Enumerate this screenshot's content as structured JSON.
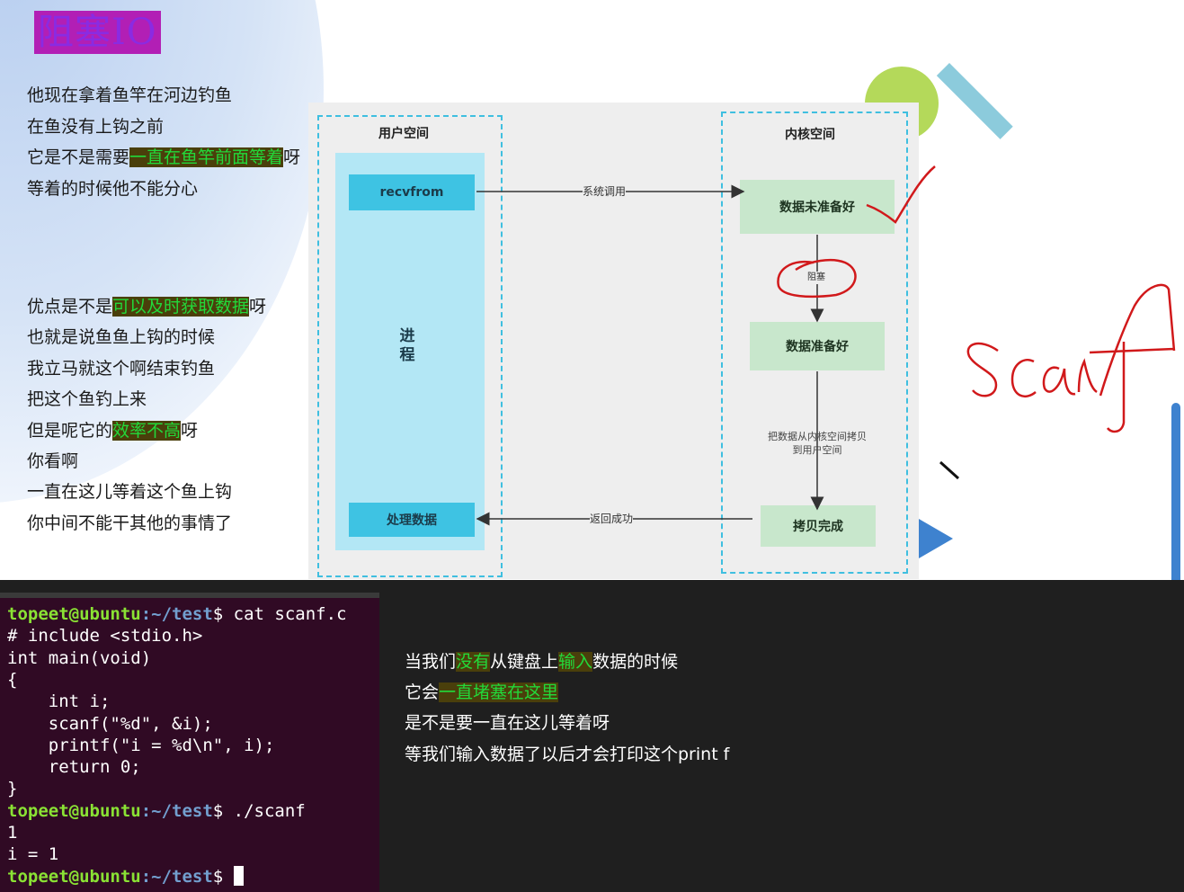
{
  "slide": {
    "title": "阻塞IO",
    "narration_top": [
      {
        "before": "他现在拿着鱼竿在河边钓鱼",
        "highlight": "",
        "after": ""
      },
      {
        "before": "在鱼没有上钩之前",
        "highlight": "",
        "after": ""
      },
      {
        "before": "它是不是需要",
        "highlight": "一直在鱼竿前面等着",
        "after": "呀"
      },
      {
        "before": "等着的时候他不能分心",
        "highlight": "",
        "after": ""
      }
    ],
    "narration_bottom": [
      {
        "before": "优点是不是",
        "highlight": "可以及时获取数据",
        "after": "呀"
      },
      {
        "before": "也就是说鱼鱼上钩的时候",
        "highlight": "",
        "after": ""
      },
      {
        "before": "我立马就这个啊结束钓鱼",
        "highlight": "",
        "after": ""
      },
      {
        "before": "把这个鱼钓上来",
        "highlight": "",
        "after": ""
      },
      {
        "before": "但是呢它的",
        "highlight": "效率不高",
        "after": "呀"
      },
      {
        "before": "你看啊",
        "highlight": "",
        "after": ""
      },
      {
        "before": "一直在这儿等着这个鱼上钩",
        "highlight": "",
        "after": ""
      },
      {
        "before": "你中间不能干其他的事情了",
        "highlight": "",
        "after": ""
      }
    ],
    "diagram": {
      "user_space_title": "用户空间",
      "kernel_space_title": "内核空间",
      "recvfrom": "recvfrom",
      "process_label": "进\n程",
      "process_data": "处理数据",
      "syscall": "系统调用",
      "data_not_ready": "数据未准备好",
      "block": "阻塞",
      "data_ready": "数据准备好",
      "copy_label_1": "把数据从内核空间拷贝",
      "copy_label_2": "到用户空间",
      "copy_done": "拷贝完成",
      "return_success": "返回成功"
    },
    "handwriting": "scanf",
    "colors": {
      "title_bg": "#b21fb5",
      "highlight_bg": "#4a3f0b",
      "highlight_fg": "#22d93a",
      "ink": "#d1191b"
    }
  },
  "terminal": {
    "user": "topeet@ubuntu",
    "path": ":~/test",
    "lines": [
      {
        "type": "prompt",
        "cmd": "$ cat scanf.c"
      },
      {
        "type": "out",
        "text": "# include <stdio.h>"
      },
      {
        "type": "out",
        "text": "int main(void)"
      },
      {
        "type": "out",
        "text": "{"
      },
      {
        "type": "out",
        "text": "    int i;"
      },
      {
        "type": "out",
        "text": "    scanf(\"%d\", &i);"
      },
      {
        "type": "out",
        "text": "    printf(\"i = %d\\n\", i);"
      },
      {
        "type": "out",
        "text": "    return 0;"
      },
      {
        "type": "out",
        "text": "}"
      },
      {
        "type": "prompt",
        "cmd": "$ ./scanf"
      },
      {
        "type": "out",
        "text": "1"
      },
      {
        "type": "out",
        "text": "i = 1"
      },
      {
        "type": "prompt",
        "cmd": "$ "
      }
    ]
  },
  "subtitles": [
    [
      {
        "t": "当我们",
        "h": false
      },
      {
        "t": "没有",
        "h": true
      },
      {
        "t": "从键盘上",
        "h": false
      },
      {
        "t": "输入",
        "h": true
      },
      {
        "t": "数据的时候",
        "h": false
      }
    ],
    [
      {
        "t": "它会",
        "h": false
      },
      {
        "t": "一直堵塞在这里",
        "h": true
      }
    ],
    [
      {
        "t": "是不是要一直在这儿等着呀",
        "h": false
      }
    ],
    [
      {
        "t": "等我们输入数据了以后才会打印这个print f",
        "h": false
      }
    ]
  ]
}
